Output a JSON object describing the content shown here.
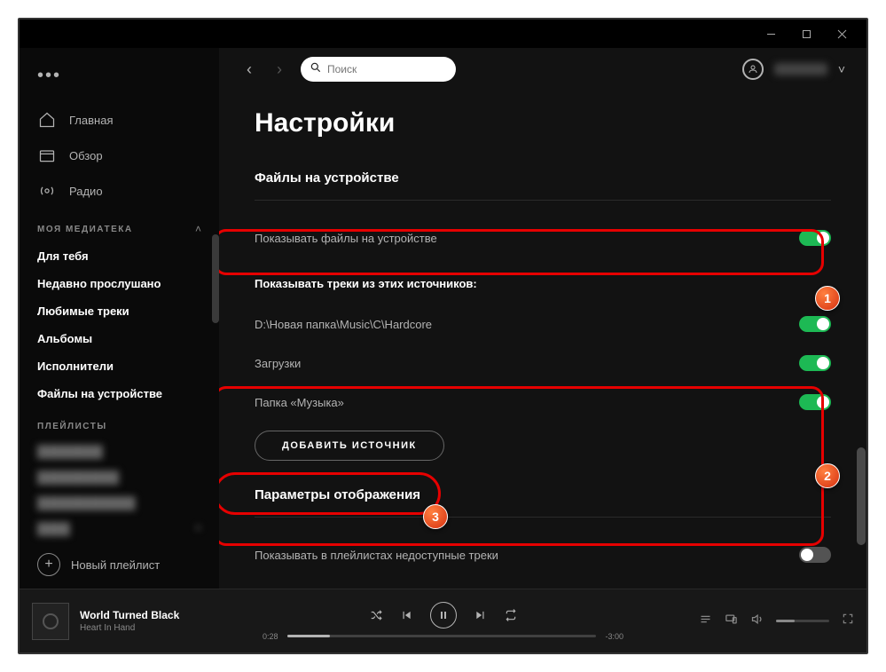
{
  "titlebar": {
    "min": "—",
    "max": "▢",
    "close": "✕"
  },
  "sidebar": {
    "more": "•••",
    "nav": [
      {
        "label": "Главная"
      },
      {
        "label": "Обзор"
      },
      {
        "label": "Радио"
      }
    ],
    "library_header": "МОЯ МЕДИАТЕКА",
    "library": [
      "Для тебя",
      "Недавно прослушано",
      "Любимые треки",
      "Альбомы",
      "Исполнители",
      "Файлы на устройстве"
    ],
    "playlists_header": "ПЛЕЙЛИСТЫ",
    "new_playlist": "Новый плейлист"
  },
  "topbar": {
    "search_placeholder": "Поиск"
  },
  "settings": {
    "title": "Настройки",
    "local_files_header": "Файлы на устройстве",
    "show_local": "Показывать файлы на устройстве",
    "sources_header": "Показывать треки из этих источников:",
    "sources": [
      {
        "path": "D:\\Новая папка\\Music\\C\\Hardcore",
        "on": true
      },
      {
        "path": "Загрузки",
        "on": true
      },
      {
        "path": "Папка «Музыка»",
        "on": true
      }
    ],
    "add_source": "ДОБАВИТЬ ИСТОЧНИК",
    "display_header": "Параметры отображения",
    "show_unavailable": "Показывать в плейлистах недоступные треки"
  },
  "player": {
    "track": "World Turned Black",
    "artist": "Heart In Hand",
    "elapsed": "0:28",
    "remaining": "-3:00",
    "progress_pct": 14
  },
  "badges": {
    "b1": "1",
    "b2": "2",
    "b3": "3"
  }
}
